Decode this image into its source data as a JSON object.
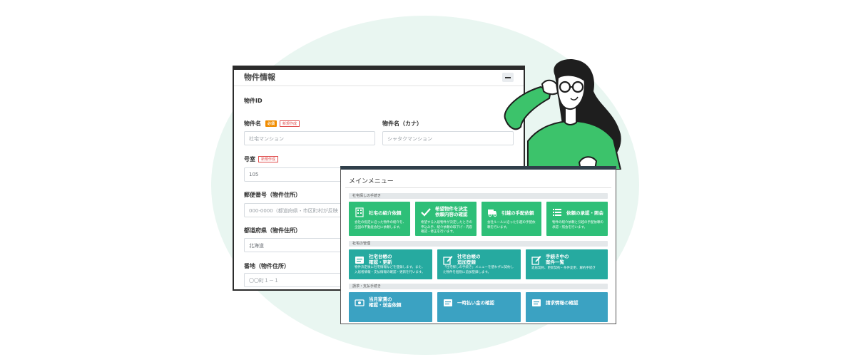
{
  "form": {
    "title": "物件情報",
    "collapse_icon": "minus-icon",
    "property_id_label": "物件ID",
    "property_name_label": "物件名",
    "property_name_required": "必須",
    "property_name_new": "新規作成",
    "property_name_placeholder": "社宅マンション",
    "property_kana_label": "物件名（カナ）",
    "property_kana_placeholder": "シャタクマンション",
    "room_label": "号室",
    "room_new": "新規作成",
    "room_value": "105",
    "postal_label": "郵便番号（物件住所）",
    "postal_placeholder": "000-0000（都道府県・市区町村が反映",
    "prefecture_label": "都道府県（物件住所）",
    "prefecture_value": "北海道",
    "address_label": "番地（物件住所）",
    "address_placeholder": "〇〇町１－１"
  },
  "menu": {
    "title": "メインメニュー",
    "sections": [
      {
        "label": "社宅探しの手続き",
        "tiles": [
          {
            "title": "社宅の紹介依頼",
            "desc": "会社の指定に沿った物件の紹介を、全国の不動産会社に依頼します。",
            "icon": "building-icon"
          },
          {
            "title": "希望物件を決定\n依頼内容の確認",
            "desc": "希望する入居物件が決定したときの申込み手、紹介依頼の取下げ・内容確認・修正を行います。",
            "icon": "checkmark-icon"
          },
          {
            "title": "引越の手配依頼",
            "desc": "会社ルールに沿った引越の手配依頼を行います。",
            "icon": "truck-icon"
          },
          {
            "title": "依頼の承認・照会",
            "desc": "物件の紹介依頼と引越の手配依頼の承認・照会を行います。",
            "icon": "list-icon"
          }
        ]
      },
      {
        "label": "社宅の管理",
        "tiles": [
          {
            "title": "社宅台帳の\n確認・更新",
            "desc": "物件決定後に社宅情報などを登録します。また、入居者情報・支払情報の確認・更新を行います。",
            "icon": "card-icon"
          },
          {
            "title": "社宅台帳の\n追加登録",
            "desc": "「社宅探しの手続き」メニューを使わずに契約した物件を個別に追加登録します。",
            "icon": "edit-icon"
          },
          {
            "title": "手続き中の\n案件一覧",
            "desc": "退居契約、更新契約・条件変更、解約手続き",
            "icon": "pencil-icon"
          }
        ]
      },
      {
        "label": "請求・支払手続き",
        "tiles": [
          {
            "title": "当月家賃の\n確認・送金依頼",
            "desc": "",
            "icon": "money-icon"
          },
          {
            "title": "一時払い金の確認",
            "desc": "",
            "icon": "card-icon"
          },
          {
            "title": "請求情報の確認",
            "desc": "",
            "icon": "card-icon"
          }
        ]
      }
    ]
  },
  "colors": {
    "green": "#2ebf78",
    "teal": "#26aaa0",
    "blue": "#3ba2c2",
    "shirt": "#3cc36b"
  }
}
